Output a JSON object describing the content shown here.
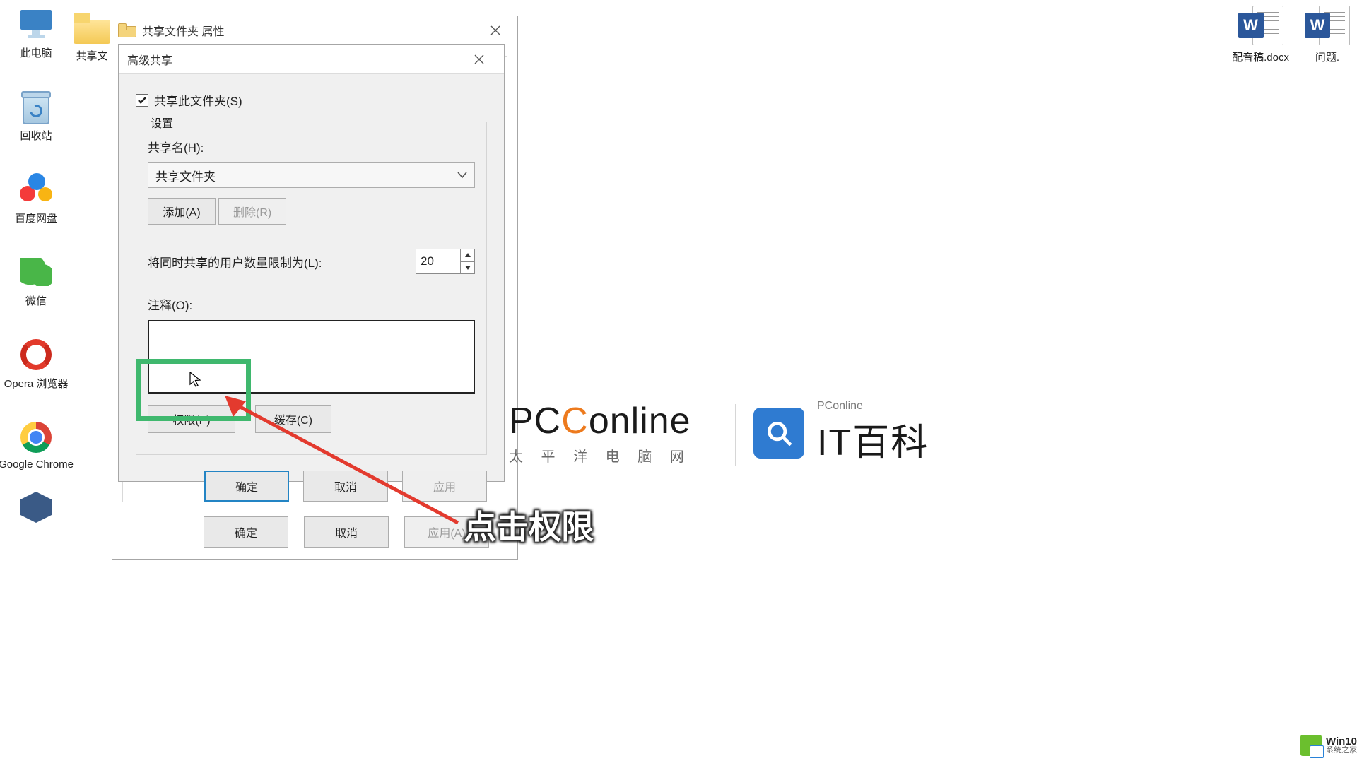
{
  "desktop": {
    "items": [
      {
        "label": "此电脑",
        "icon": "pc"
      },
      {
        "label": "回收站",
        "icon": "bin"
      },
      {
        "label": "百度网盘",
        "icon": "baidu"
      },
      {
        "label": "微信",
        "icon": "wechat"
      },
      {
        "label": "Opera 浏览器",
        "icon": "opera"
      },
      {
        "label": "Google Chrome",
        "icon": "chrome"
      }
    ],
    "bg_folder_label": "共享文",
    "docs": [
      {
        "label": "配音稿.docx"
      },
      {
        "label": "问题."
      }
    ]
  },
  "back_dialog": {
    "title": "共享文件夹 属性",
    "buttons": {
      "ok": "确定",
      "cancel": "取消",
      "apply": "应用(A)"
    }
  },
  "front_dialog": {
    "title": "高级共享",
    "checkbox_label": "共享此文件夹(S)",
    "checkbox_checked": true,
    "group_legend": "设置",
    "share_name_label": "共享名(H):",
    "share_name_value": "共享文件夹",
    "add_btn": "添加(A)",
    "remove_btn": "删除(R)",
    "limit_label": "将同时共享的用户数量限制为(L):",
    "limit_value": "20",
    "comment_label": "注释(O):",
    "perm_btn": "权限(P)",
    "cache_btn": "缓存(C)",
    "buttons": {
      "ok": "确定",
      "cancel": "取消",
      "apply": "应用"
    }
  },
  "annotation": {
    "caption": "点击权限"
  },
  "watermark1": {
    "text_prefix": "PC",
    "text_rest": "online",
    "sub": "太 平 洋 电 脑 网"
  },
  "watermark2": {
    "s1": "PConline",
    "s2": "IT百科"
  },
  "corner_badge": {
    "a": "Win10",
    "b": "系统之家"
  }
}
